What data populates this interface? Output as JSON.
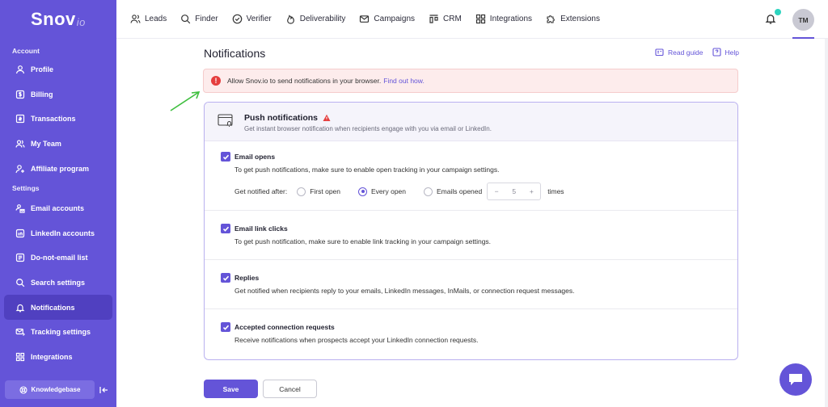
{
  "brand": {
    "name": "Snov",
    "suffix": "io"
  },
  "sidebar": {
    "account_label": "Account",
    "account_items": [
      {
        "label": "Profile",
        "icon": "user-icon"
      },
      {
        "label": "Billing",
        "icon": "dollar-icon"
      },
      {
        "label": "Transactions",
        "icon": "receipt-icon"
      },
      {
        "label": "My Team",
        "icon": "team-icon"
      },
      {
        "label": "Affiliate program",
        "icon": "user-plus-icon"
      }
    ],
    "settings_label": "Settings",
    "settings_items": [
      {
        "label": "Email accounts",
        "icon": "email-accounts-icon"
      },
      {
        "label": "LinkedIn accounts",
        "icon": "linkedin-icon"
      },
      {
        "label": "Do-not-email list",
        "icon": "list-icon"
      },
      {
        "label": "Search settings",
        "icon": "search-icon"
      },
      {
        "label": "Notifications",
        "icon": "bell-icon",
        "active": true
      },
      {
        "label": "Tracking settings",
        "icon": "tracking-icon"
      },
      {
        "label": "Integrations",
        "icon": "grid-icon"
      }
    ],
    "knowledgebase": "Knowledgebase"
  },
  "nav": [
    {
      "label": "Leads",
      "icon": "leads-icon"
    },
    {
      "label": "Finder",
      "icon": "search-icon"
    },
    {
      "label": "Verifier",
      "icon": "check-circle-icon"
    },
    {
      "label": "Deliverability",
      "icon": "flame-icon"
    },
    {
      "label": "Campaigns",
      "icon": "mail-icon"
    },
    {
      "label": "CRM",
      "icon": "crm-icon"
    },
    {
      "label": "Integrations",
      "icon": "grid-icon"
    },
    {
      "label": "Extensions",
      "icon": "puzzle-icon"
    }
  ],
  "user": {
    "initials": "TM"
  },
  "page": {
    "title": "Notifications",
    "read_guide": "Read guide",
    "help": "Help"
  },
  "alert": {
    "text": "Allow Snov.io to send notifications in your browser.",
    "link": "Find out how."
  },
  "card": {
    "title": "Push notifications",
    "subtitle": "Get instant browser notification when recipients engage with you via email or LinkedIn.",
    "options": [
      {
        "title": "Email opens",
        "desc": "To get push notifications, make sure to enable open tracking in your campaign settings.",
        "checked": true
      },
      {
        "title": "Email link clicks",
        "desc": "To get push notification, make sure to enable link tracking in your campaign settings.",
        "checked": true
      },
      {
        "title": "Replies",
        "desc": "Get notified when recipients reply to your emails, LinkedIn messages, InMails, or connection request messages.",
        "checked": true
      },
      {
        "title": "Accepted connection requests",
        "desc": "Receive notifications when prospects accept your LinkedIn connection requests.",
        "checked": true
      }
    ],
    "notify": {
      "label": "Get notified after:",
      "first": "First open",
      "every": "Every open",
      "opened": "Emails opened",
      "selected": "Every open",
      "minus": "−",
      "count": "5",
      "plus": "+",
      "times": "times"
    }
  },
  "buttons": {
    "save": "Save",
    "cancel": "Cancel"
  },
  "colors": {
    "accent": "#6454d8",
    "alert_bg": "#fdecec",
    "error": "#e53e3e",
    "dot": "#2dd4bf"
  }
}
